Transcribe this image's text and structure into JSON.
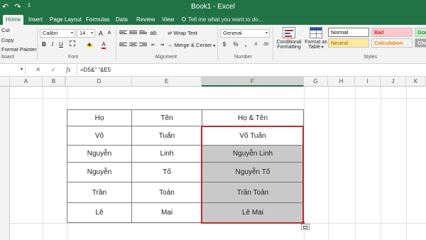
{
  "titlebar": {
    "undo": "↶",
    "redo": "↷",
    "customize": "⇩",
    "title": "Book1 - Excel"
  },
  "tabs": [
    {
      "label": "Home",
      "active": true
    },
    {
      "label": "Insert"
    },
    {
      "label": "Page Layout"
    },
    {
      "label": "Formulas"
    },
    {
      "label": "Data"
    },
    {
      "label": "Review"
    },
    {
      "label": "View"
    }
  ],
  "tellme": "Tell me what you want to do...",
  "ribbon": {
    "clipboard": {
      "cut": "Cut",
      "copy": "Copy",
      "format_painter": "Format Painter",
      "label": "board"
    },
    "font": {
      "name": "Calibri",
      "size": "14",
      "bold": "B",
      "italic": "I",
      "underline": "U",
      "label": "Font"
    },
    "alignment": {
      "wrap_text": "Wrap Text",
      "merge_center": "Merge & Center",
      "label": "Alignment"
    },
    "number": {
      "format": "General",
      "currency": "$",
      "percent": "%",
      "comma": ",",
      "label": "Number"
    },
    "styles": {
      "conditional_formatting_line1": "Conditional",
      "conditional_formatting_line2": "Formatting",
      "format_as_table_line1": "Format as",
      "format_as_table_line2": "Table",
      "normal": "Normal",
      "bad": "Bad",
      "good": "Goo",
      "neutral": "Neutral",
      "calculation": "Calculation",
      "check": "Che",
      "label": "Styles"
    }
  },
  "formula_bar": {
    "cancel": "✕",
    "enter": "✓",
    "fx": "fx",
    "formula": "=D5&\" \"&E5"
  },
  "columns": [
    "A",
    "B",
    "C",
    "D",
    "E",
    "F",
    "G",
    "H",
    "I",
    "J",
    "K"
  ],
  "table": {
    "headers": [
      "Họ",
      "Tên",
      "Họ & Tên"
    ],
    "rows": [
      [
        "Võ",
        "Tuấn",
        "Võ Tuấn"
      ],
      [
        "Nguyễn",
        "Linh",
        "Nguyễn Linh"
      ],
      [
        "Nguyễn",
        "Tố",
        "Nguyễn Tố"
      ],
      [
        "Trần",
        "Toản",
        "Trần Toản"
      ],
      [
        "Lê",
        "Mai",
        "Lê Mai"
      ]
    ]
  },
  "colors": {
    "excel_green": "#217346",
    "selection_border": "#c0282c",
    "filled_cells": "#c9c9c9"
  }
}
